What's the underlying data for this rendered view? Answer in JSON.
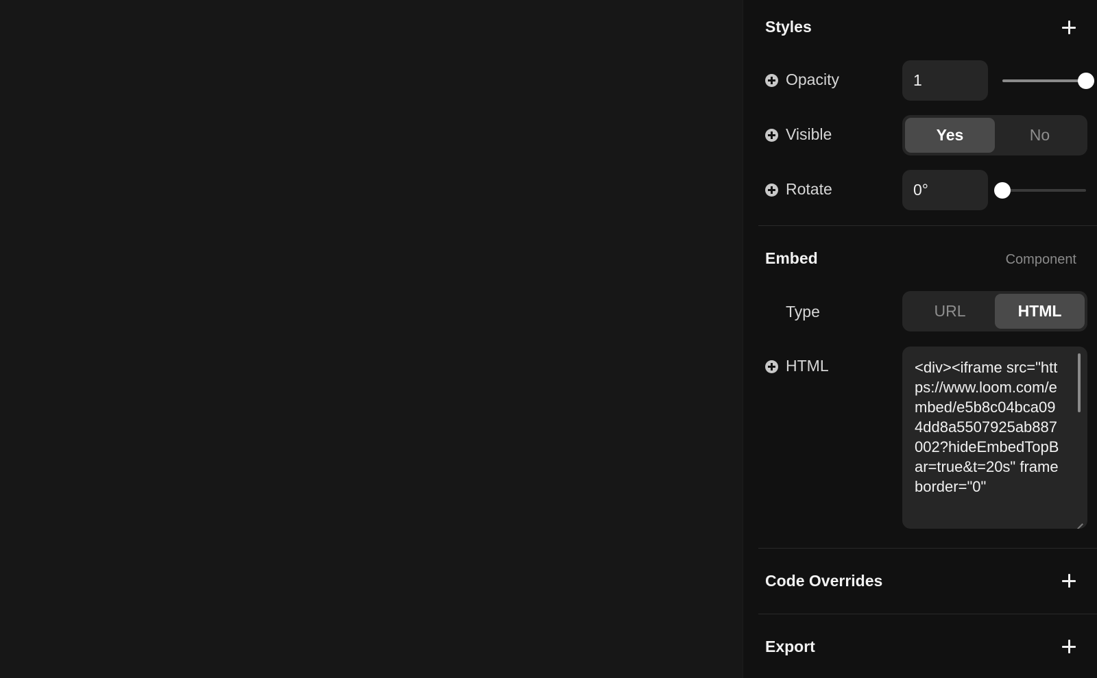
{
  "styles": {
    "title": "Styles",
    "opacity": {
      "label": "Opacity",
      "value": "1",
      "level": 1.0
    },
    "visible": {
      "label": "Visible",
      "options": [
        "Yes",
        "No"
      ],
      "selected": "Yes"
    },
    "rotate": {
      "label": "Rotate",
      "value": "0°",
      "level": 0.0
    }
  },
  "embed": {
    "title": "Embed",
    "component_label": "Component",
    "type": {
      "label": "Type",
      "options": [
        "URL",
        "HTML"
      ],
      "selected": "HTML"
    },
    "html": {
      "label": "HTML",
      "value": "<div><iframe src=\"https://www.loom.com/embed/e5b8c04bca094dd8a5507925ab887002?hideEmbedTopBar=true&t=20s\" frameborder=\"0\""
    }
  },
  "code_overrides": {
    "title": "Code Overrides"
  },
  "export": {
    "title": "Export"
  },
  "colors": {
    "background": "#171717",
    "panel": "#111111",
    "input": "#262626",
    "active_segment": "#4a4a4a"
  },
  "icons": [
    "plus-icon",
    "add-circle-icon",
    "resize-handle-icon"
  ]
}
